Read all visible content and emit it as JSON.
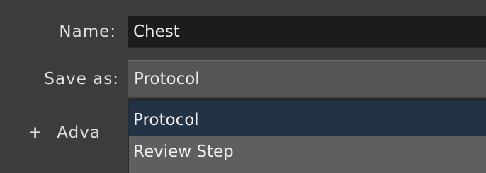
{
  "form": {
    "name_label": "Name:",
    "name_value": "Chest",
    "save_as_label": "Save as:",
    "save_as_value": "Protocol",
    "advanced_icon": "plus-icon",
    "advanced_label": "Adva"
  },
  "dropdown": {
    "options": [
      {
        "label": "Protocol",
        "selected": true
      },
      {
        "label": "Review Step",
        "selected": false
      }
    ]
  },
  "colors": {
    "background": "#3c3c3c",
    "input_bg": "#1c1c1c",
    "select_bg": "#555555",
    "highlight": "#233346",
    "option_bg": "#5f5f5f"
  }
}
